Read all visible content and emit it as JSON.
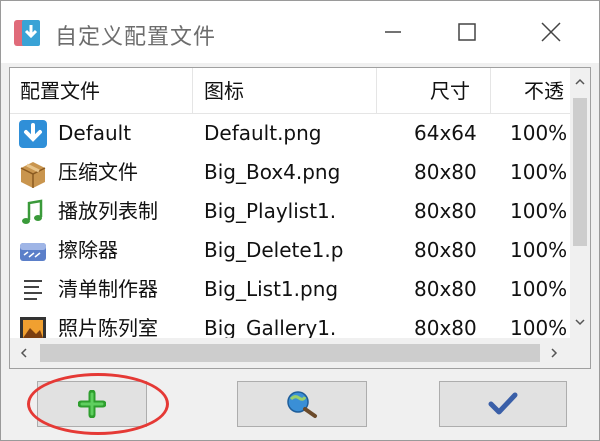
{
  "window": {
    "title": "自定义配置文件",
    "buttons": {
      "minimize": "minimize-icon",
      "maximize": "maximize-icon",
      "close": "close-icon"
    }
  },
  "table": {
    "columns": [
      "配置文件",
      "图标",
      "尺寸",
      "不透"
    ],
    "rows": [
      {
        "name": "Default",
        "icon_file": "Default.png",
        "size": "64x64",
        "opacity": "100%",
        "icon": "download-arrow-icon"
      },
      {
        "name": "压缩文件",
        "icon_file": "Big_Box4.png",
        "size": "80x80",
        "opacity": "100%",
        "icon": "box-icon"
      },
      {
        "name": "播放列表制",
        "icon_file": "Big_Playlist1.",
        "size": "80x80",
        "opacity": "100%",
        "icon": "music-note-icon"
      },
      {
        "name": "擦除器",
        "icon_file": "Big_Delete1.p",
        "size": "80x80",
        "opacity": "100%",
        "icon": "eraser-icon"
      },
      {
        "name": "清单制作器",
        "icon_file": "Big_List1.png",
        "size": "80x80",
        "opacity": "100%",
        "icon": "list-icon"
      },
      {
        "name": "照片陈列室",
        "icon_file": "Big_Gallery1.",
        "size": "80x80",
        "opacity": "100%",
        "icon": "gallery-icon"
      }
    ]
  },
  "buttons": {
    "add": "plus-icon",
    "search": "magnifier-globe-icon",
    "ok": "checkmark-icon"
  },
  "colors": {
    "highlight": "#e53935",
    "add_plus": "#2e9e2e",
    "ok_check": "#3a5fa8"
  }
}
